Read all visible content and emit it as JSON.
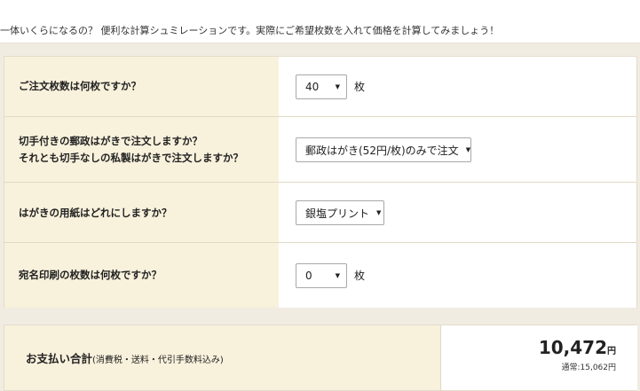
{
  "intro": "一体いくらになるの？ 便利な計算シュミレーションです。実際にご希望枚数を入れて価格を計算してみましょう！",
  "form": {
    "rows": [
      {
        "question": "ご注文枚数は何枚ですか？",
        "value": "40",
        "unit": "枚"
      },
      {
        "question": "切手付きの郵政はがきで注文しますか？\nそれとも切手なしの私製はがきで注文しますか？",
        "value": "郵政はがき(52円/枚)のみで注文",
        "unit": ""
      },
      {
        "question": "はがきの用紙はどれにしますか？",
        "value": "銀塩プリント",
        "unit": ""
      },
      {
        "question": "宛名印刷の枚数は何枚ですか？",
        "value": "0",
        "unit": "枚"
      }
    ]
  },
  "total": {
    "label": "お支払い合計",
    "note": "(消費税・送料・代引手数料込み)",
    "price": "10,472",
    "price_unit": "円",
    "regular": "通常:15,062円"
  },
  "icons": {
    "dropdown": "chevron-down-icon"
  }
}
